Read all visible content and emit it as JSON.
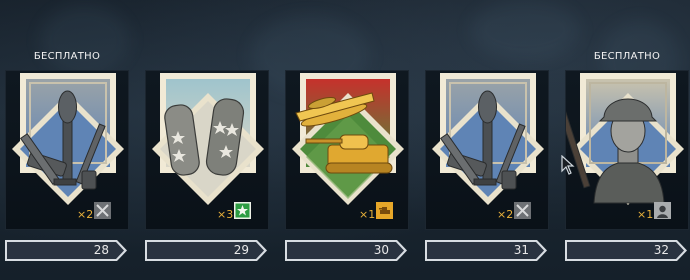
{
  "calendar": {
    "days": [
      {
        "free_label": "БЕСПЛАТНО",
        "quantity": "×2",
        "reward_icon": "crossed-weapons-icon",
        "reward_art": "weapons-bundle",
        "day_number": "28"
      },
      {
        "free_label": "",
        "quantity": "×3",
        "reward_icon": "green-star-icon",
        "reward_art": "shoulder-straps",
        "day_number": "29"
      },
      {
        "free_label": "",
        "quantity": "×1",
        "reward_icon": "gold-tank-icon",
        "reward_art": "gold-plane-and-tank",
        "day_number": "30"
      },
      {
        "free_label": "",
        "quantity": "×2",
        "reward_icon": "crossed-weapons-icon",
        "reward_art": "weapons-bundle",
        "day_number": "31"
      },
      {
        "free_label": "БЕСПЛАТНО",
        "quantity": "×1",
        "reward_icon": "soldier-portrait-icon",
        "reward_art": "soldier-portrait",
        "day_number": "32"
      }
    ]
  },
  "colors": {
    "quantity": "#e8b13a",
    "day_bar": "#d8dde2",
    "panel": "#0f1820"
  }
}
